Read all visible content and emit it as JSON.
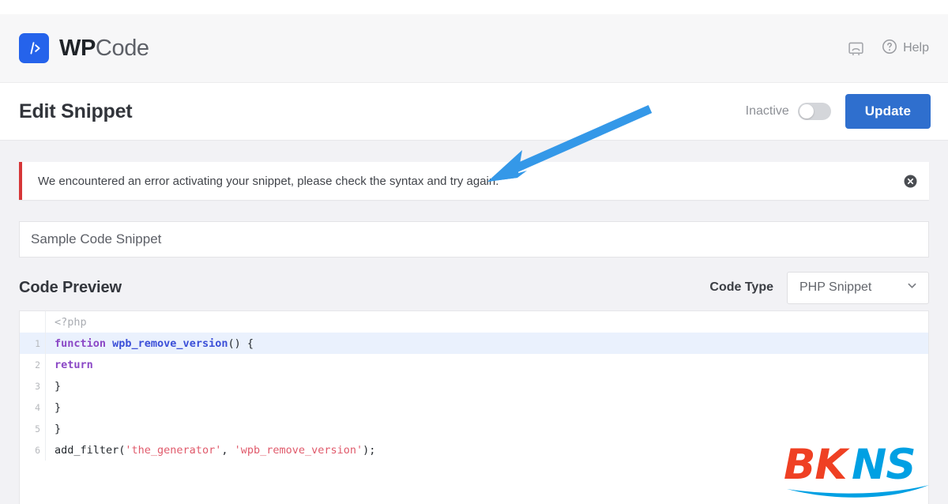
{
  "header": {
    "brand_prefix": "WP",
    "brand_suffix": "Code",
    "brand_mark_icon": "code-brackets-icon",
    "video_icon": "video-screen-icon",
    "help_icon": "question-circle-icon",
    "help_label": "Help",
    "brand_color": "#2563eb"
  },
  "title_bar": {
    "page_title": "Edit Snippet",
    "toggle_label": "Inactive",
    "toggle_state": "off",
    "update_label": "Update",
    "update_color": "#2f6fce"
  },
  "notice": {
    "message": "We encountered an error activating your snippet, please check the syntax and try again.",
    "accent_color": "#d63638",
    "dismiss_icon": "close-circle-icon"
  },
  "snippet_name": {
    "value": "Sample Code Snippet",
    "placeholder": "Sample Code Snippet"
  },
  "code_preview": {
    "section_title": "Code Preview",
    "code_type_label": "Code Type",
    "code_type_value": "PHP Snippet",
    "chevron_icon": "chevron-down-icon",
    "lines": [
      {
        "number": "",
        "active": false,
        "tokens": [
          {
            "t": "<?php",
            "c": "tk-gray"
          }
        ]
      },
      {
        "number": "1",
        "active": true,
        "tokens": [
          {
            "t": "function ",
            "c": "tk-kw"
          },
          {
            "t": "wpb_remove_version",
            "c": "tk-fn"
          },
          {
            "t": "() {",
            "c": "tk-punct"
          }
        ]
      },
      {
        "number": "2",
        "active": false,
        "tokens": [
          {
            "t": "return",
            "c": "tk-kw"
          }
        ]
      },
      {
        "number": "3",
        "active": false,
        "tokens": [
          {
            "t": "}",
            "c": "tk-plain"
          }
        ]
      },
      {
        "number": "4",
        "active": false,
        "tokens": [
          {
            "t": "}",
            "c": "tk-plain"
          }
        ]
      },
      {
        "number": "5",
        "active": false,
        "tokens": [
          {
            "t": "}",
            "c": "tk-plain"
          }
        ]
      },
      {
        "number": "6",
        "active": false,
        "tokens": [
          {
            "t": "add_filter(",
            "c": "tk-plain"
          },
          {
            "t": "'the_generator'",
            "c": "tk-str"
          },
          {
            "t": ", ",
            "c": "tk-plain"
          },
          {
            "t": "'wpb_remove_version'",
            "c": "tk-str"
          },
          {
            "t": ");",
            "c": "tk-plain"
          }
        ]
      }
    ]
  },
  "annotation": {
    "arrow_color": "#3498e8",
    "arrow_direction": "down-left"
  },
  "watermark": {
    "part1": "BK",
    "part2": "NS",
    "color1": "#ef4023",
    "color2": "#00a0e3"
  }
}
